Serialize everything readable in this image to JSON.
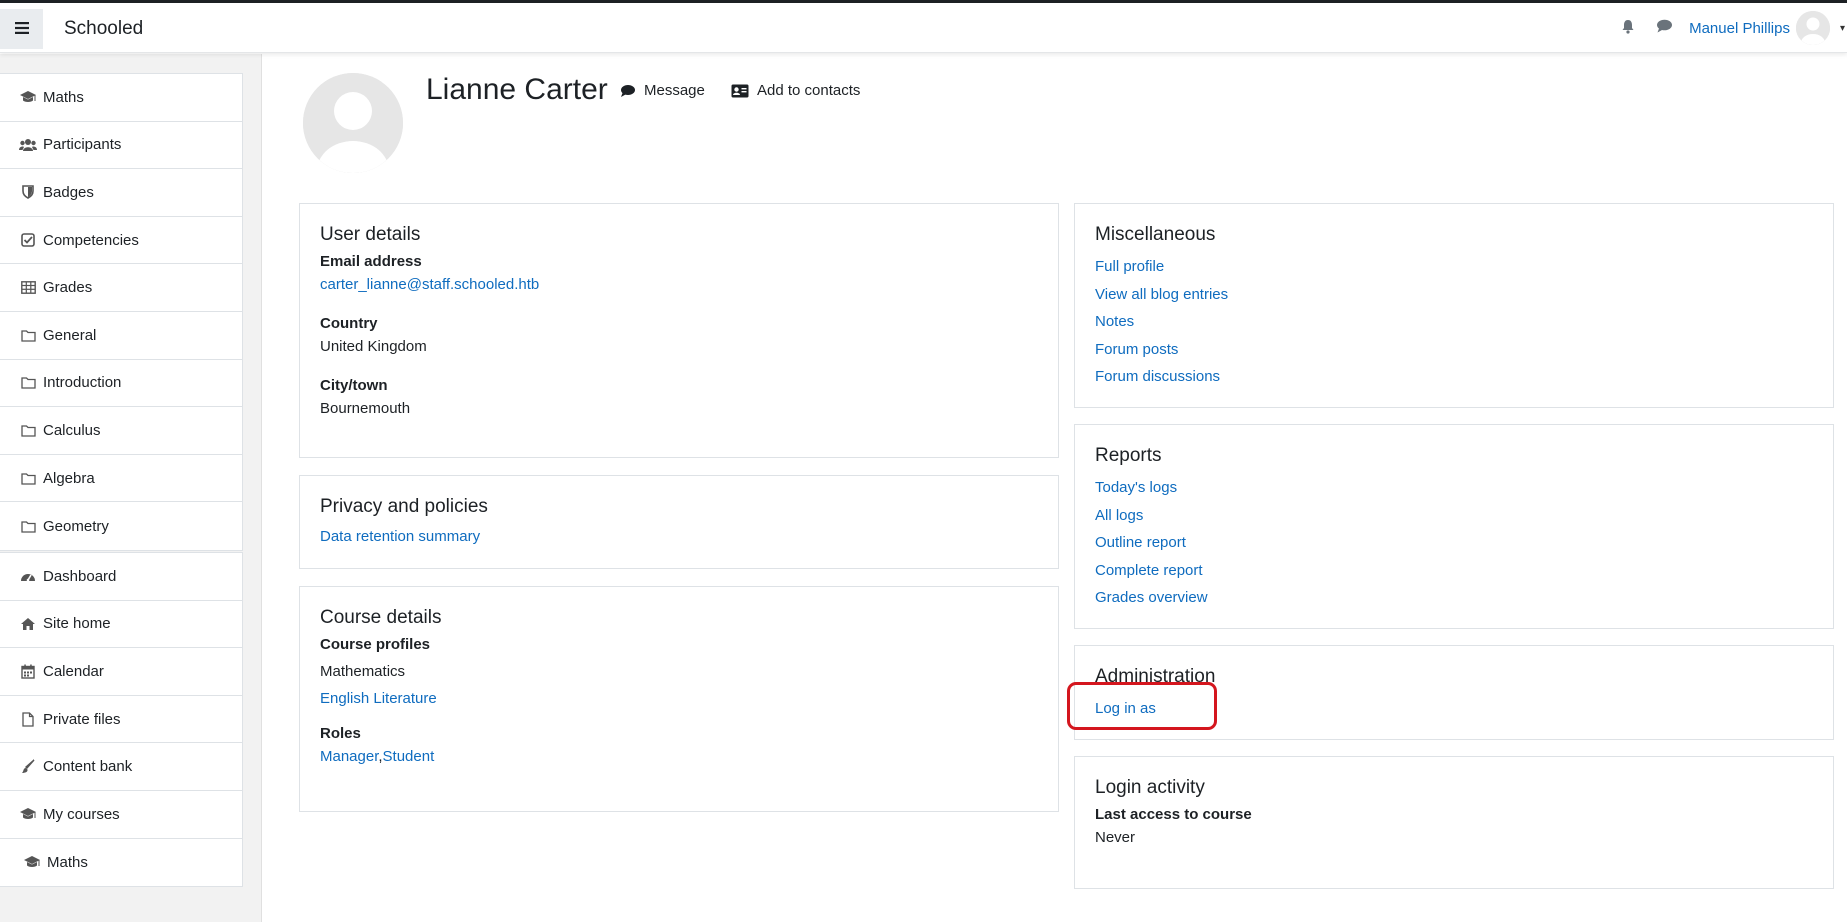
{
  "colors": {
    "link": "#0f6cbf",
    "highlight": "#d4161e",
    "sidebar_bg": "#f2f2f2"
  },
  "navbar": {
    "brand": "Schooled",
    "user_name": "Manuel Phillips",
    "icons": [
      "menu-icon",
      "bell-icon",
      "chat-icon",
      "user-avatar",
      "caret-down-icon"
    ]
  },
  "sidebar": {
    "course_items": [
      {
        "label": "Maths",
        "icon": "graduation-cap-icon"
      },
      {
        "label": "Participants",
        "icon": "users-icon"
      },
      {
        "label": "Badges",
        "icon": "shield-icon"
      },
      {
        "label": "Competencies",
        "icon": "check-square-icon"
      },
      {
        "label": "Grades",
        "icon": "table-icon"
      },
      {
        "label": "General",
        "icon": "folder-icon"
      },
      {
        "label": "Introduction",
        "icon": "folder-icon"
      },
      {
        "label": "Calculus",
        "icon": "folder-icon"
      },
      {
        "label": "Algebra",
        "icon": "folder-icon"
      },
      {
        "label": "Geometry",
        "icon": "folder-icon"
      }
    ],
    "site_items": [
      {
        "label": "Dashboard",
        "icon": "dashboard-icon"
      },
      {
        "label": "Site home",
        "icon": "home-icon"
      },
      {
        "label": "Calendar",
        "icon": "calendar-icon"
      },
      {
        "label": "Private files",
        "icon": "file-icon"
      },
      {
        "label": "Content bank",
        "icon": "brush-icon"
      },
      {
        "label": "My courses",
        "icon": "graduation-cap-icon"
      },
      {
        "label": "Maths",
        "icon": "graduation-cap-icon"
      }
    ]
  },
  "profile": {
    "name": "Lianne Carter",
    "message_label": "Message",
    "add_contacts_label": "Add to contacts"
  },
  "user_details": {
    "title": "User details",
    "email_label": "Email address",
    "email_value": "carter_lianne@staff.schooled.htb",
    "country_label": "Country",
    "country_value": "United Kingdom",
    "city_label": "City/town",
    "city_value": "Bournemouth"
  },
  "privacy": {
    "title": "Privacy and policies",
    "link": "Data retention summary"
  },
  "course_details": {
    "title": "Course details",
    "profiles_label": "Course profiles",
    "profile_1": "Mathematics",
    "profile_2": "English Literature",
    "roles_label": "Roles",
    "role_1": "Manager",
    "role_sep": ",",
    "role_2": "Student"
  },
  "miscellaneous": {
    "title": "Miscellaneous",
    "links": [
      "Full profile",
      "View all blog entries",
      "Notes",
      "Forum posts",
      "Forum discussions"
    ]
  },
  "reports": {
    "title": "Reports",
    "links": [
      "Today's logs",
      "All logs",
      "Outline report",
      "Complete report",
      "Grades overview"
    ]
  },
  "administration": {
    "title": "Administration",
    "link": "Log in as"
  },
  "login_activity": {
    "title": "Login activity",
    "last_access_label": "Last access to course",
    "last_access_value": "Never"
  }
}
